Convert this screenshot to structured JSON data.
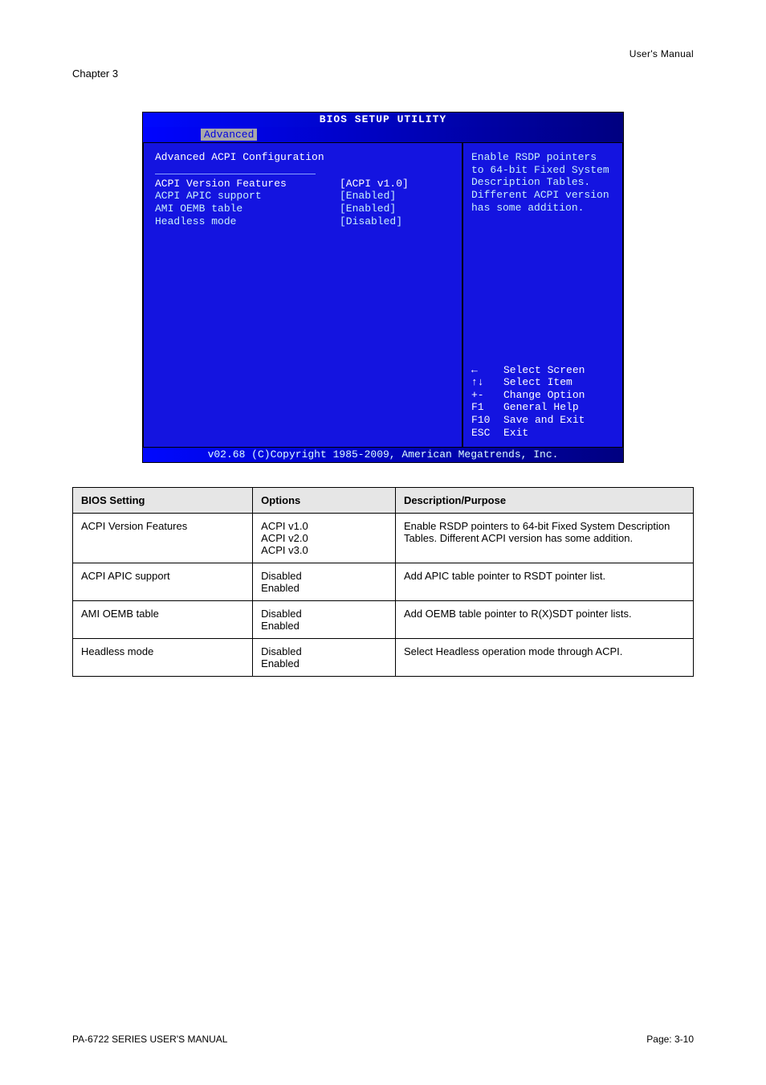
{
  "header_right": "User's Manual",
  "chapter_label": "Chapter 3",
  "bios": {
    "title": "BIOS SETUP UTILITY",
    "tab": "Advanced",
    "section": "Advanced ACPI Configuration",
    "rows": [
      {
        "label": "ACPI Version Features",
        "value": "[ACPI v1.0]"
      },
      {
        "label": "ACPI APIC support",
        "value": "[Enabled]"
      },
      {
        "label": "AMI OEMB table",
        "value": "[Enabled]"
      },
      {
        "label": "Headless mode",
        "value": "[Disabled]"
      }
    ],
    "help": "Enable RSDP pointers to 64-bit Fixed System Description Tables. Different ACPI version has some addition.",
    "legend": [
      {
        "key": "←",
        "label": "Select Screen"
      },
      {
        "key": "↑↓",
        "label": "Select Item"
      },
      {
        "key": "+-",
        "label": "Change Option"
      },
      {
        "key": "F1",
        "label": "General Help"
      },
      {
        "key": "F10",
        "label": "Save and Exit"
      },
      {
        "key": "ESC",
        "label": "Exit"
      }
    ],
    "footer": "v02.68 (C)Copyright 1985-2009, American Megatrends, Inc."
  },
  "table": {
    "headers": [
      "BIOS Setting",
      "Options",
      "Description/Purpose"
    ],
    "rows": [
      {
        "c1": "ACPI Version Features",
        "c2": "ACPI v1.0\nACPI v2.0\nACPI v3.0",
        "c3": "Enable RSDP pointers to 64-bit Fixed System Description Tables. Different ACPI version has some addition."
      },
      {
        "c1": "ACPI APIC support",
        "c2": "Disabled\nEnabled",
        "c3": "Add APIC table pointer to RSDT pointer list."
      },
      {
        "c1": "AMI OEMB table",
        "c2": "Disabled\nEnabled",
        "c3": "Add OEMB table pointer to R(X)SDT pointer lists."
      },
      {
        "c1": "Headless mode",
        "c2": "Disabled\nEnabled",
        "c3": "Select Headless operation mode through ACPI."
      }
    ]
  },
  "footer_left_product": "PA-6722 SERIES USER'S MANUAL",
  "footer_page": "Page: 3-10"
}
